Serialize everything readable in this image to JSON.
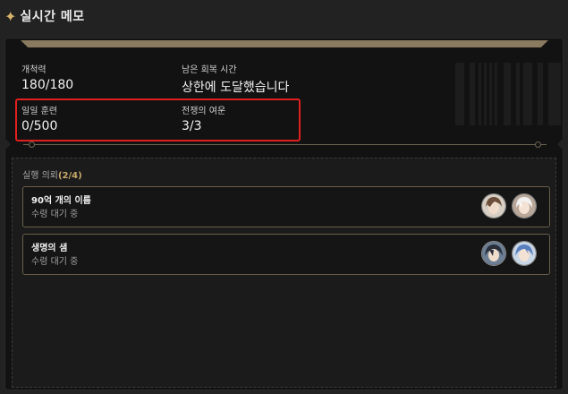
{
  "header": {
    "title": "실시간 메모"
  },
  "stats": [
    {
      "label": "개척력",
      "value": "180/180"
    },
    {
      "label": "남은 회복 시간",
      "value": "상한에 도달했습니다"
    },
    {
      "label": "일일 훈련",
      "value": "0/500"
    },
    {
      "label": "전쟁의 여운",
      "value": "3/3"
    }
  ],
  "dispatch": {
    "title": "실행 의뢰",
    "count": "(2/4)",
    "missions": [
      {
        "name": "90억 개의 이름",
        "status": "수령 대기 중",
        "avatars": [
          "avatar-brown-hair-icon",
          "avatar-white-hair-icon"
        ]
      },
      {
        "name": "생명의 샘",
        "status": "수령 대기 중",
        "avatars": [
          "avatar-dark-hair-icon",
          "avatar-blue-hair-icon"
        ]
      }
    ]
  },
  "colors": {
    "accent_gold": "#8a7a5f",
    "highlight_red": "#e0201f",
    "panel": "#121212"
  }
}
